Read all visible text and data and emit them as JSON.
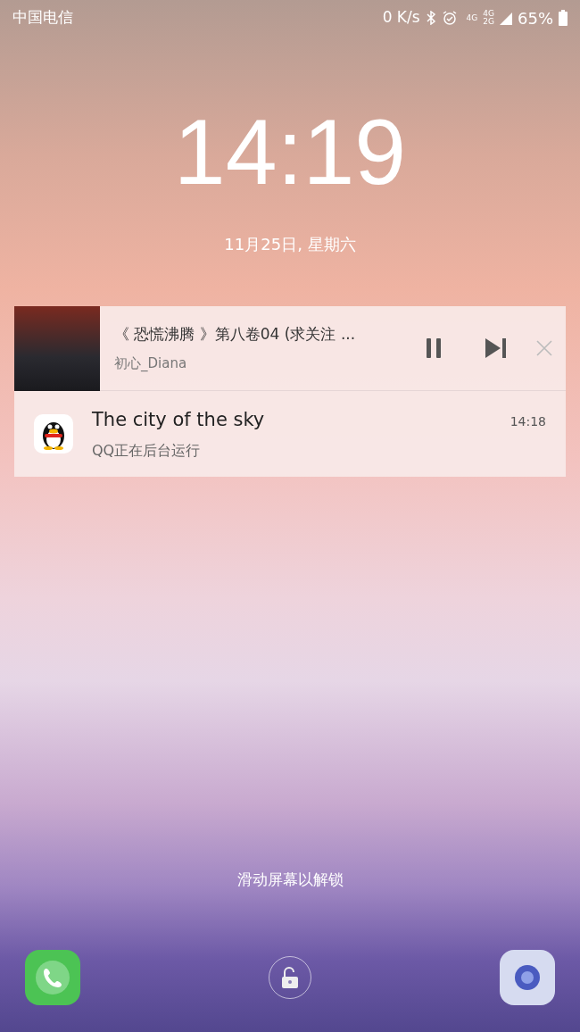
{
  "status_bar": {
    "carrier": "中国电信",
    "net_speed": "0 K/s",
    "network_labels": [
      "4G",
      "4G",
      "2G"
    ],
    "battery": "65%"
  },
  "clock": {
    "time": "14:19",
    "date": "11月25日, 星期六"
  },
  "media_notification": {
    "title": "《 恐慌沸腾 》第八卷04 (求关注 ...",
    "artist": "初心_Diana",
    "playing": true
  },
  "notifications": [
    {
      "title": "The city of the sky",
      "subtitle": "QQ正在后台运行",
      "time": "14:18"
    }
  ],
  "unlock_hint": "滑动屏幕以解锁"
}
